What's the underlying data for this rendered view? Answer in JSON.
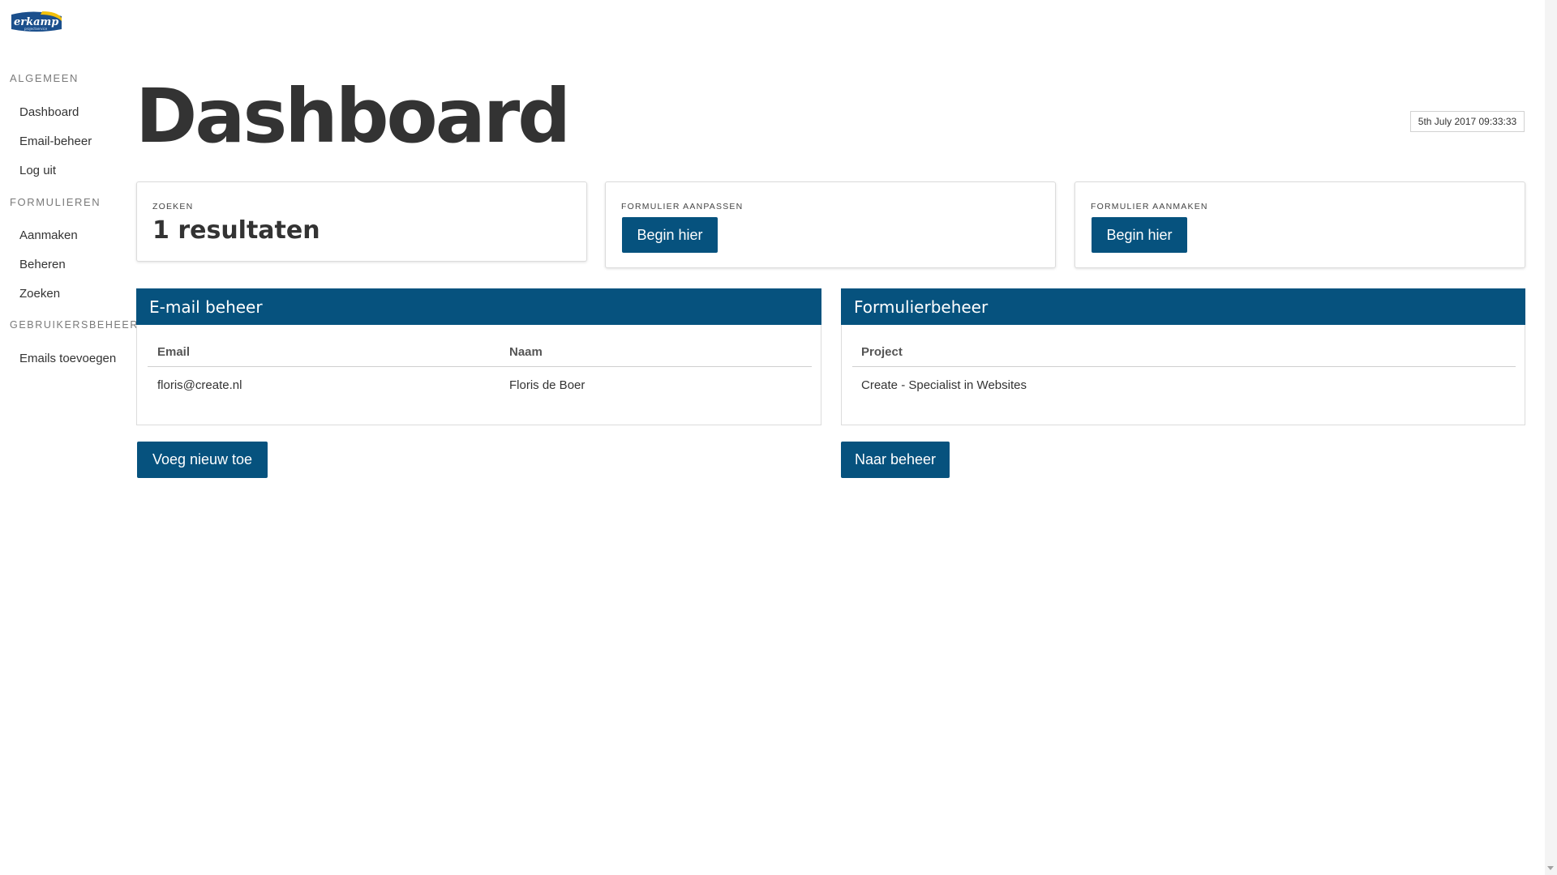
{
  "brand": {
    "logo_text": "erkamp",
    "logo_subtext": "projectservice",
    "colors": {
      "primary": "#06527e",
      "logo_yellow": "#f2c00b",
      "logo_blue": "#1b4f8c"
    }
  },
  "sidebar": {
    "sections": [
      {
        "title": "ALGEMEEN",
        "items": [
          {
            "label": "Dashboard"
          },
          {
            "label": "Email-beheer"
          },
          {
            "label": "Log uit"
          }
        ]
      },
      {
        "title": "FORMULIEREN",
        "items": [
          {
            "label": "Aanmaken"
          },
          {
            "label": "Beheren"
          },
          {
            "label": "Zoeken"
          }
        ]
      },
      {
        "title": "GEBRUIKERSBEHEER",
        "items": [
          {
            "label": "Emails toevoegen"
          }
        ]
      }
    ]
  },
  "header": {
    "title": "Dashboard",
    "timestamp": "5th July 2017 09:33:33"
  },
  "cards": [
    {
      "label": "ZOEKEN",
      "value": "1 resultaten"
    },
    {
      "label": "FORMULIER AANPASSEN",
      "button": "Begin hier"
    },
    {
      "label": "FORMULIER AANMAKEN",
      "button": "Begin hier"
    }
  ],
  "email_panel": {
    "title": "E-mail beheer",
    "columns": [
      "Email",
      "Naam"
    ],
    "rows": [
      [
        "floris@create.nl",
        "Floris de Boer"
      ]
    ],
    "button": "Voeg nieuw toe"
  },
  "form_panel": {
    "title": "Formulierbeheer",
    "columns": [
      "Project"
    ],
    "rows": [
      [
        "Create - Specialist in Websites"
      ]
    ],
    "button": "Naar beheer"
  },
  "icons": {
    "scroll_down": "chevron-down-icon"
  }
}
